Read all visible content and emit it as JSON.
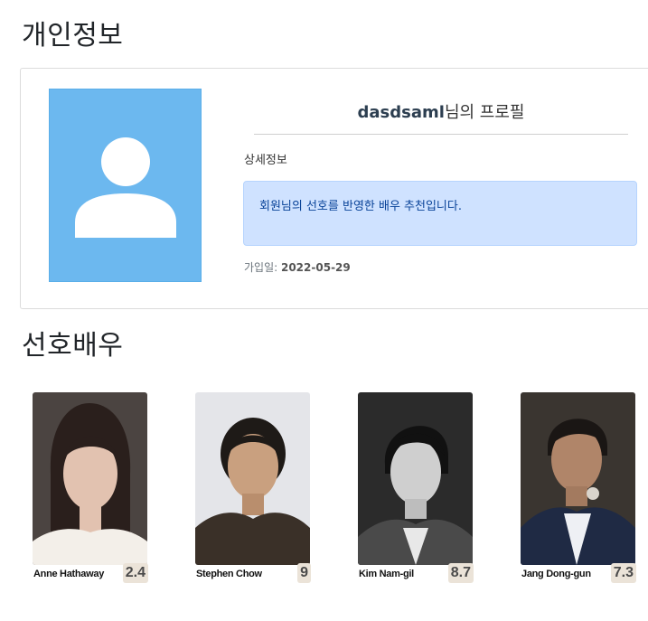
{
  "page": {
    "personal_title": "개인정보",
    "actors_title": "선호배우"
  },
  "profile": {
    "username": "dasdsaml",
    "title_suffix": "님의 프로필",
    "detail_label": "상세정보",
    "recommend_message": "회원님의 선호를 반영한 배우 추천입니다.",
    "joined_label": "가입일: ",
    "joined_date": "2022-05-29"
  },
  "actors": [
    {
      "name": "Anne Hathaway",
      "score": "2.4",
      "photo_bg": "#4b4441"
    },
    {
      "name": "Stephen Chow",
      "score": "9",
      "photo_bg": "#e4e5e9"
    },
    {
      "name": "Kim Nam-gil",
      "score": "8.7",
      "photo_bg": "#2b2b2b"
    },
    {
      "name": "Jang Dong-gun",
      "score": "7.3",
      "photo_bg": "#3a3530"
    }
  ],
  "colors": {
    "avatar_bg": "#6cb8ef",
    "info_bg": "#cfe2ff",
    "info_text": "#084298",
    "score_bg": "#ebe3d8"
  }
}
